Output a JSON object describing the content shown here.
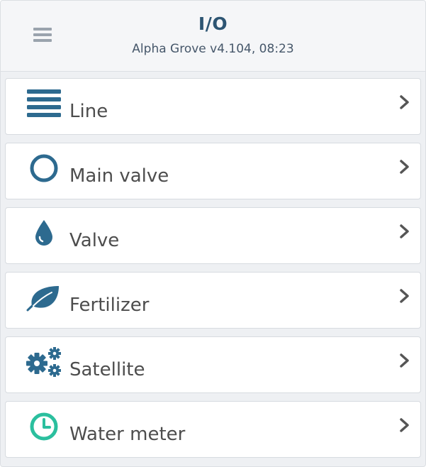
{
  "header": {
    "title": "I/O",
    "subtitle": "Alpha Grove v4.104, 08:23",
    "menu_icon": "hamburger-menu-icon"
  },
  "colors": {
    "primary": "#2d6a8f",
    "accent_teal": "#2bbf9e",
    "text": "#4d4d4d",
    "chevron": "#555555"
  },
  "items": [
    {
      "label": "Line",
      "icon": "line-list-icon"
    },
    {
      "label": "Main valve",
      "icon": "circle-ring-icon"
    },
    {
      "label": "Valve",
      "icon": "water-drop-icon"
    },
    {
      "label": "Fertilizer",
      "icon": "leaf-icon"
    },
    {
      "label": "Satellite",
      "icon": "gears-icon"
    },
    {
      "label": "Water meter",
      "icon": "clock-icon"
    }
  ]
}
